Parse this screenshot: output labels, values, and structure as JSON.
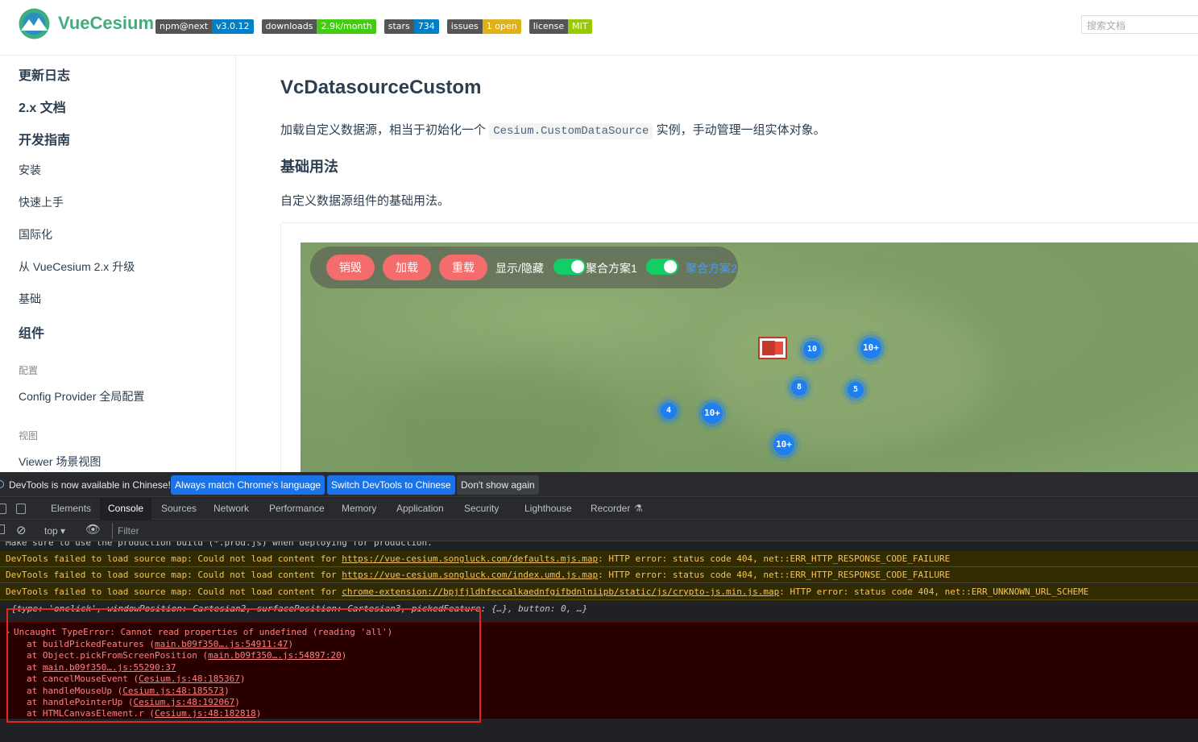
{
  "header": {
    "site_title": "VueCesium",
    "badges": [
      {
        "label": "npm@next",
        "value": "v3.0.12",
        "color": "#007ec6"
      },
      {
        "label": "downloads",
        "value": "2.9k/month",
        "color": "#4c1"
      },
      {
        "label": "stars",
        "value": "734",
        "color": "#007ec6"
      },
      {
        "label": "issues",
        "value": "1 open",
        "color": "#dfb317"
      },
      {
        "label": "license",
        "value": "MIT",
        "color": "#97ca00"
      }
    ],
    "search_placeholder": "搜索文档"
  },
  "sidebar": {
    "changelog": "更新日志",
    "docs_2x": "2.x 文档",
    "guide": "开发指南",
    "install": "安装",
    "quickstart": "快速上手",
    "i18n": "国际化",
    "upgrade": "从 VueCesium 2.x 升级",
    "basic": "基础",
    "components": "组件",
    "group_config": "配置",
    "config_provider": "Config Provider 全局配置",
    "group_view": "视图",
    "viewer": "Viewer 场景视图"
  },
  "content": {
    "page_title": "VcDatasourceCustom",
    "desc_before": "加载自定义数据源，相当于初始化一个",
    "desc_code": "Cesium.CustomDataSource",
    "desc_after": "实例，手动管理一组实体对象。",
    "section_title": "基础用法",
    "section_desc": "自定义数据源组件的基础用法。"
  },
  "demo": {
    "btn_destroy": "销毁",
    "btn_load": "加载",
    "btn_reload": "重载",
    "show_hide": "显示/隐藏",
    "cluster1": "聚合方案1",
    "cluster2": "聚合方案2",
    "clusters": [
      {
        "label": "10"
      },
      {
        "label": "10+"
      },
      {
        "label": "8"
      },
      {
        "label": "5"
      },
      {
        "label": "4"
      },
      {
        "label": "10+"
      },
      {
        "label": "10+"
      }
    ]
  },
  "devtools": {
    "infobar_text": "DevTools is now available in Chinese!",
    "btn_always_match": "Always match Chrome's language",
    "btn_switch_chinese": "Switch DevTools to Chinese",
    "btn_dont_show": "Don't show again",
    "tabs": [
      "Elements",
      "Console",
      "Sources",
      "Network",
      "Performance",
      "Memory",
      "Application",
      "Security",
      "Lighthouse",
      "Recorder"
    ],
    "active_tab": "Console",
    "context": "top",
    "filter_placeholder": "Filter",
    "log_partial": "Make sure to use the production build (*.prod.js) when deploying for production.",
    "warnings": [
      {
        "prefix": "DevTools failed to load source map: Could not load content for ",
        "url": "https://vue-cesium.songluck.com/defaults.mjs.map",
        "suffix": ": HTTP error: status code 404, net::ERR_HTTP_RESPONSE_CODE_FAILURE"
      },
      {
        "prefix": "DevTools failed to load source map: Could not load content for ",
        "url": "https://vue-cesium.songluck.com/index.umd.js.map",
        "suffix": ": HTTP error: status code 404, net::ERR_HTTP_RESPONSE_CODE_FAILURE"
      },
      {
        "prefix": "DevTools failed to load source map: Could not load content for ",
        "url": "chrome-extension://bpjfjldhfeccalkaednfgifbdnlniipb/static/js/crypto-js.min.js.map",
        "suffix": ": HTTP error: status code 404, net::ERR_UNKNOWN_URL_SCHEME"
      }
    ],
    "object_log": "{type: 'onclick', windowPosition: Cartesian2, surfacePosition: Cartesian3, pickedFeature: {…}, button: 0, …}",
    "error_title": "Uncaught TypeError: Cannot read properties of undefined (reading 'all')",
    "stack": [
      {
        "fn": "at buildPickedFeatures (",
        "loc": "main.b09f350….js:54911:47",
        "end": ")"
      },
      {
        "fn": "at Object.pickFromScreenPosition (",
        "loc": "main.b09f350….js:54897:20",
        "end": ")"
      },
      {
        "fn": "at ",
        "loc": "main.b09f350….js:55290:37",
        "end": ""
      },
      {
        "fn": "at cancelMouseEvent (",
        "loc": "Cesium.js:48:185367",
        "end": ")"
      },
      {
        "fn": "at handleMouseUp (",
        "loc": "Cesium.js:48:185573",
        "end": ")"
      },
      {
        "fn": "at handlePointerUp (",
        "loc": "Cesium.js:48:192067",
        "end": ")"
      },
      {
        "fn": "at HTMLCanvasElement.r (",
        "loc": "Cesium.js:48:182818",
        "end": ")"
      }
    ]
  }
}
